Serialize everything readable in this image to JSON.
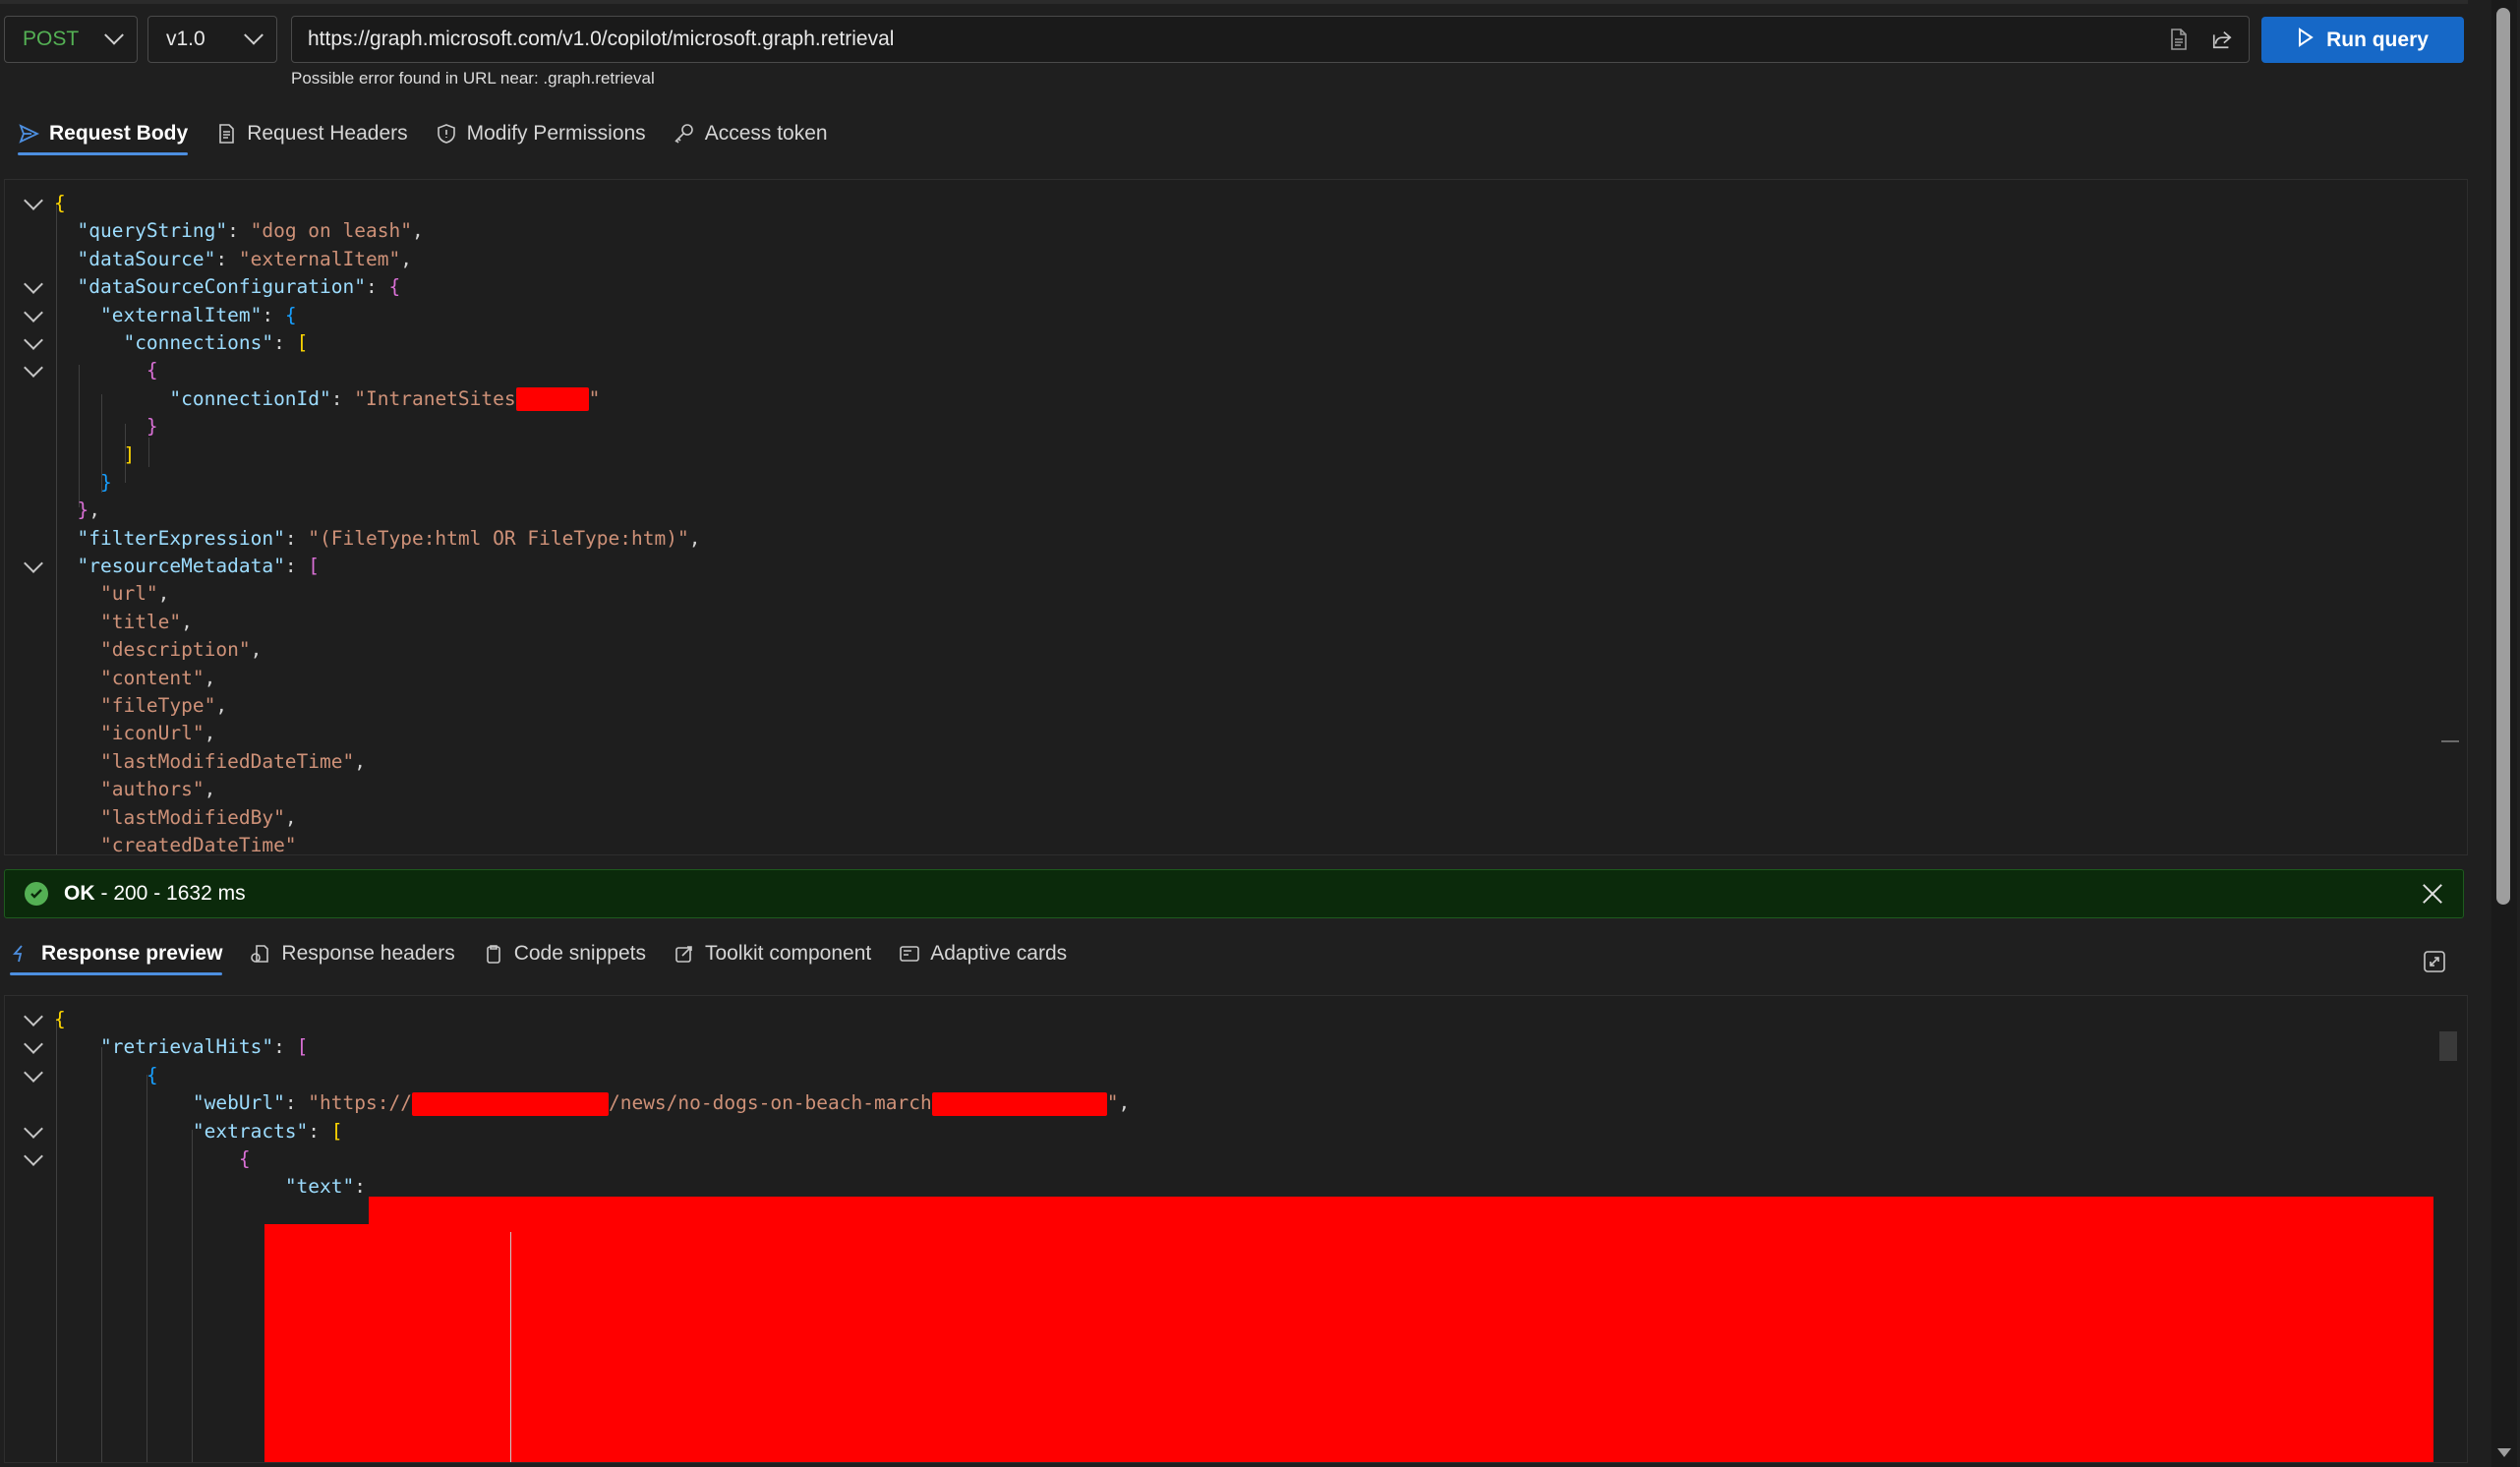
{
  "request": {
    "method": "POST",
    "version": "v1.0",
    "url": "https://graph.microsoft.com/v1.0/copilot/microsoft.graph.retrieval",
    "url_warning": "Possible error found in URL near: .graph.retrieval",
    "run_label": "Run query"
  },
  "request_tabs": [
    {
      "label": "Request Body",
      "icon": "send-icon",
      "active": true
    },
    {
      "label": "Request Headers",
      "icon": "document-icon",
      "active": false
    },
    {
      "label": "Modify Permissions",
      "icon": "shield-icon",
      "active": false
    },
    {
      "label": "Access token",
      "icon": "key-icon",
      "active": false
    }
  ],
  "request_body": {
    "queryString_key": "\"queryString\"",
    "queryString_val": "\"dog on leash\"",
    "dataSource_key": "\"dataSource\"",
    "dataSource_val": "\"externalItem\"",
    "dataSourceConfiguration_key": "\"dataSourceConfiguration\"",
    "externalItem_key": "\"externalItem\"",
    "connections_key": "\"connections\"",
    "connectionId_key": "\"connectionId\"",
    "connectionId_val": "\"IntranetSites",
    "filterExpression_key": "\"filterExpression\"",
    "filterExpression_val": "\"(FileType:html OR FileType:htm)\"",
    "resourceMetadata_key": "\"resourceMetadata\"",
    "resourceMetadata": [
      "\"url\"",
      "\"title\"",
      "\"description\"",
      "\"content\"",
      "\"fileType\"",
      "\"iconUrl\"",
      "\"lastModifiedDateTime\"",
      "\"authors\"",
      "\"lastModifiedBy\"",
      "\"createdDateTime\""
    ]
  },
  "status": {
    "label": "OK",
    "text": "- 200 - 1632 ms"
  },
  "response_tabs": [
    {
      "label": "Response preview",
      "icon": "preview-icon",
      "active": true
    },
    {
      "label": "Response headers",
      "icon": "headers-icon",
      "active": false
    },
    {
      "label": "Code snippets",
      "icon": "clipboard-icon",
      "active": false
    },
    {
      "label": "Toolkit component",
      "icon": "toolkit-icon",
      "active": false
    },
    {
      "label": "Adaptive cards",
      "icon": "card-icon",
      "active": false
    }
  ],
  "response_body": {
    "retrievalHits_key": "\"retrievalHits\"",
    "webUrl_key": "\"webUrl\"",
    "webUrl_prefix": "\"https://",
    "webUrl_mid": "/news/no-dogs-on-beach-march",
    "extracts_key": "\"extracts\"",
    "text_key": "\"text\""
  }
}
